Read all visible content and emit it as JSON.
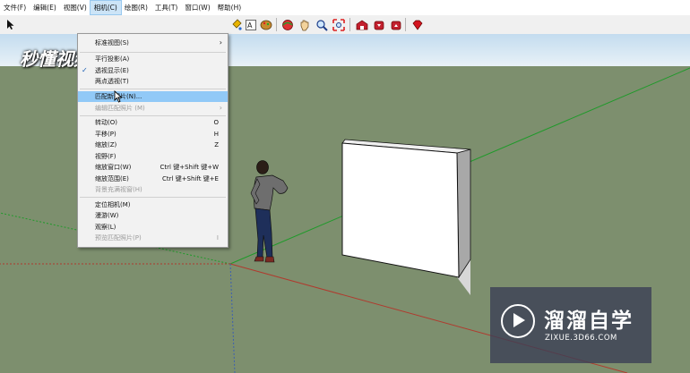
{
  "menubar": {
    "items": [
      "文件(F)",
      "编辑(E)",
      "视图(V)",
      "相机(C)",
      "绘图(R)",
      "工具(T)",
      "窗口(W)",
      "帮助(H)"
    ],
    "active_index": 3
  },
  "toolbar": {
    "icons": [
      "select-arrow-icon",
      "paint-bucket-icon",
      "text-icon",
      "paint-icon",
      "orbit-icon",
      "pan-hand-icon",
      "zoom-icon",
      "zoom-extents-icon",
      "warehouse-icon",
      "get-models-icon",
      "share-model-icon",
      "ruby-icon"
    ]
  },
  "watermark_top": "秒懂视频",
  "watermark_logo": {
    "title": "溜溜自学",
    "url": "ZIXUE.3D66.COM"
  },
  "camera_menu": {
    "items": [
      {
        "label": "标准视图(S)",
        "shortcut": "",
        "submenu": true,
        "checked": false,
        "disabled": false,
        "highlighted": false
      },
      {
        "label": "平行投影(A)",
        "shortcut": "",
        "submenu": false,
        "checked": false,
        "disabled": false,
        "highlighted": false
      },
      {
        "label": "透视显示(E)",
        "shortcut": "",
        "submenu": false,
        "checked": true,
        "disabled": false,
        "highlighted": false
      },
      {
        "label": "两点透视(T)",
        "shortcut": "",
        "submenu": false,
        "checked": false,
        "disabled": false,
        "highlighted": false
      },
      {
        "label": "匹配新照片(N)...",
        "shortcut": "",
        "submenu": false,
        "checked": false,
        "disabled": false,
        "highlighted": true
      },
      {
        "label": "编辑匹配照片 (M)",
        "shortcut": "",
        "submenu": true,
        "checked": false,
        "disabled": true,
        "highlighted": false
      },
      {
        "label": "转动(O)",
        "shortcut": "O",
        "submenu": false,
        "checked": false,
        "disabled": false,
        "highlighted": false
      },
      {
        "label": "平移(P)",
        "shortcut": "H",
        "submenu": false,
        "checked": false,
        "disabled": false,
        "highlighted": false
      },
      {
        "label": "缩放(Z)",
        "shortcut": "Z",
        "submenu": false,
        "checked": false,
        "disabled": false,
        "highlighted": false
      },
      {
        "label": "视野(F)",
        "shortcut": "",
        "submenu": false,
        "checked": false,
        "disabled": false,
        "highlighted": false
      },
      {
        "label": "缩放窗口(W)",
        "shortcut": "Ctrl 键+Shift 键+W",
        "submenu": false,
        "checked": false,
        "disabled": false,
        "highlighted": false
      },
      {
        "label": "缩放范围(E)",
        "shortcut": "Ctrl 键+Shift 键+E",
        "submenu": false,
        "checked": false,
        "disabled": false,
        "highlighted": false
      },
      {
        "label": "背景充满视窗(H)",
        "shortcut": "",
        "submenu": false,
        "checked": false,
        "disabled": true,
        "highlighted": false
      },
      {
        "label": "定位相机(M)",
        "shortcut": "",
        "submenu": false,
        "checked": false,
        "disabled": false,
        "highlighted": false
      },
      {
        "label": "漫游(W)",
        "shortcut": "",
        "submenu": false,
        "checked": false,
        "disabled": false,
        "highlighted": false
      },
      {
        "label": "观察(L)",
        "shortcut": "",
        "submenu": false,
        "checked": false,
        "disabled": false,
        "highlighted": false
      },
      {
        "label": "预览匹配照片(P)",
        "shortcut": "I",
        "submenu": false,
        "checked": false,
        "disabled": true,
        "highlighted": false
      }
    ]
  },
  "colors": {
    "ground": "#7d8f6e",
    "sky_top": "#c3dcef",
    "sky_bottom": "#e8f1f7",
    "red_axis": "#b03a2e",
    "green_axis": "#1f9a2a",
    "blue_axis": "#3c5fb0",
    "highlight": "#91c9f7"
  }
}
